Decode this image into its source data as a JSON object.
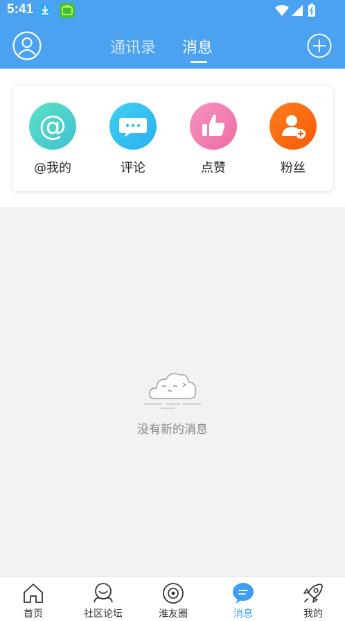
{
  "status_bar": {
    "time": "5:41"
  },
  "header": {
    "tabs": [
      {
        "label": "通讯录",
        "active": false
      },
      {
        "label": "消息",
        "active": true
      }
    ],
    "accent": "#4ba2f0"
  },
  "categories": [
    {
      "label": "@我的",
      "icon": "at-icon",
      "color": "#4dd3c4"
    },
    {
      "label": "评论",
      "icon": "comment-bubble-icon",
      "color": "#2fc0ef"
    },
    {
      "label": "点赞",
      "icon": "thumbs-up-icon",
      "color": "#f27fb0"
    },
    {
      "label": "粉丝",
      "icon": "add-fan-icon",
      "color": "#ff6a10"
    }
  ],
  "empty_state": {
    "text": "没有新的消息",
    "icon": "sleepy-cloud-icon"
  },
  "bottom_nav": [
    {
      "label": "首页",
      "icon": "home-icon",
      "active": false
    },
    {
      "label": "社区论坛",
      "icon": "community-icon",
      "active": false
    },
    {
      "label": "淮友圈",
      "icon": "friend-circle-icon",
      "active": false
    },
    {
      "label": "消息",
      "icon": "message-icon",
      "active": true
    },
    {
      "label": "我的",
      "icon": "rocket-icon",
      "active": false
    }
  ],
  "colors": {
    "active_nav": "#3d9ef2",
    "background": "#f2f2f2"
  }
}
